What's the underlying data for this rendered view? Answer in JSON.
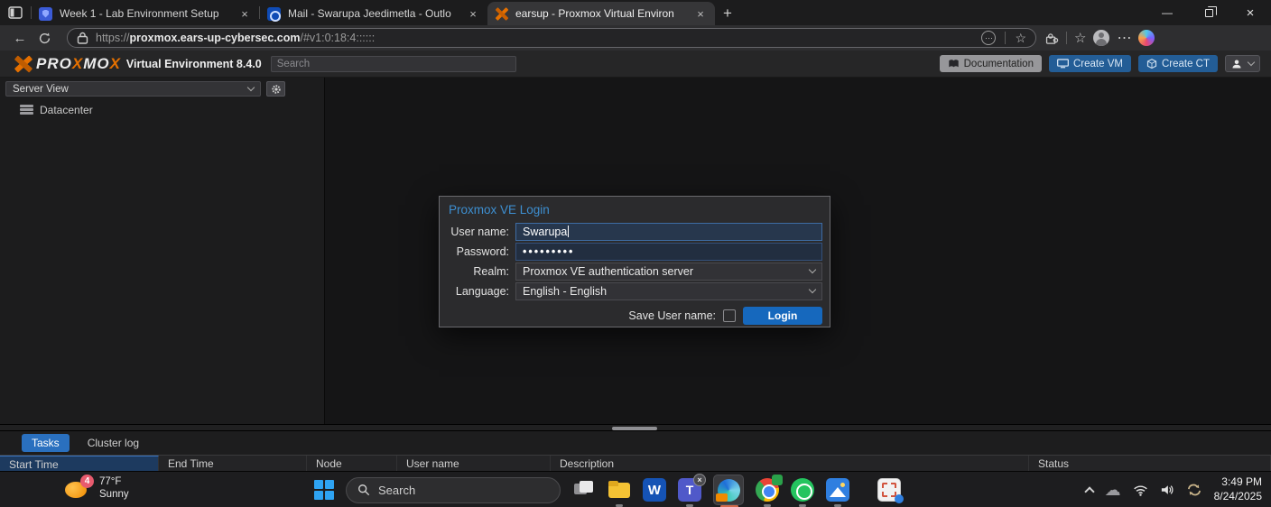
{
  "browser": {
    "tabs": [
      {
        "title": "Week 1 - Lab Environment Setup"
      },
      {
        "title": "Mail - Swarupa Jeedimetla - Outlo"
      },
      {
        "title": "earsup - Proxmox Virtual Environ"
      }
    ],
    "glyphs": {
      "back": "←",
      "new_tab": "+",
      "tab_close": "×",
      "close_window": "×",
      "minimize": "—",
      "more_menu": "⋯",
      "addr_more": "⋯",
      "favorite_star": "☆",
      "favorites_bar_star": "☆"
    },
    "address": {
      "scheme": "https://",
      "domain": "proxmox.ears-up-cybersec.com",
      "path": "/#v1:0:18:4::::::"
    }
  },
  "pve": {
    "logo": {
      "p1": "PRO",
      "p2": "X",
      "p3": "MO",
      "p4": "X"
    },
    "subtitle": "Virtual Environment 8.4.0",
    "search_placeholder": "Search",
    "actions": {
      "documentation": "Documentation",
      "create_vm": "Create VM",
      "create_ct": "Create CT"
    },
    "sidebar": {
      "view": "Server View",
      "datacenter": "Datacenter"
    },
    "login": {
      "title": "Proxmox VE Login",
      "username_label": "User name:",
      "username_value": "Swarupa",
      "password_label": "Password:",
      "password_value": "•••••••••",
      "realm_label": "Realm:",
      "realm_value": "Proxmox VE authentication server",
      "language_label": "Language:",
      "language_value": "English - English",
      "save_label": "Save User name:",
      "login_button": "Login"
    },
    "panel": {
      "tab_tasks": "Tasks",
      "tab_cluster": "Cluster log",
      "columns": [
        "Start Time",
        "End Time",
        "Node",
        "User name",
        "Description",
        "Status"
      ]
    }
  },
  "taskbar": {
    "weather": {
      "badge": "4",
      "temp": "77°F",
      "condition": "Sunny"
    },
    "search": "Search",
    "word_letter": "W",
    "teams_letter": "T",
    "teams_badge": "×",
    "clock": {
      "time": "3:49 PM",
      "date": "8/24/2025"
    }
  },
  "colors": {
    "proxmox_orange": "#e57000",
    "accent_blue": "#1668bd",
    "panel_tab_blue": "#2a70bf",
    "sorted_column_blue": "#1d3a5f"
  }
}
